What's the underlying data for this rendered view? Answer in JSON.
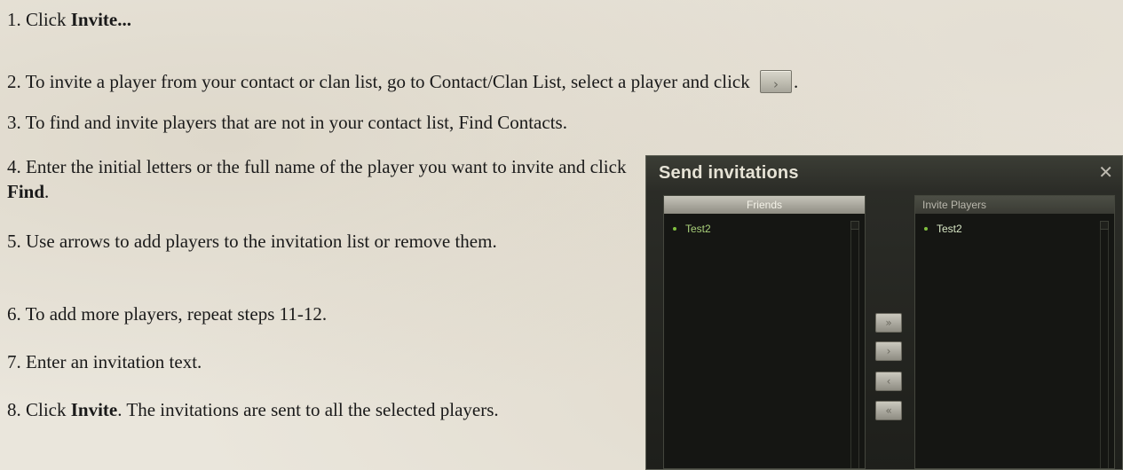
{
  "steps": [
    {
      "num": "1.",
      "pre": "Click ",
      "bold": "Invite...",
      "post": ""
    },
    {
      "num": "2.",
      "pre": "To invite a player from your contact or clan list, go to Contact/Clan List, select a player and click ",
      "button_glyph": "›",
      "post": "."
    },
    {
      "num": "3.",
      "pre": "To find and invite players that are not in your contact list, Find Contacts.",
      "bold": "",
      "post": ""
    },
    {
      "num": "4.",
      "pre": "Enter the initial letters or the full name of the player you want to invite and click ",
      "bold": "Find",
      "post": "."
    },
    {
      "num": "5.",
      "pre": "Use arrows to add players to the invitation list or remove them.",
      "bold": "",
      "post": ""
    },
    {
      "num": "6.",
      "pre": "To add more players, repeat steps 11-12.",
      "bold": "",
      "post": ""
    },
    {
      "num": "7.",
      "pre": "Enter an invitation text.",
      "bold": "",
      "post": ""
    },
    {
      "num": "8.",
      "pre": "Click ",
      "bold": "Invite",
      "post": ". The invitations are sent to all the selected players."
    }
  ],
  "dialog": {
    "title": "Send invitations",
    "close_icon": "close-icon",
    "left_panel": {
      "header": "Friends",
      "items": [
        "Test2"
      ]
    },
    "right_panel": {
      "header": "Invite Players",
      "items": [
        "Test2"
      ]
    },
    "arrows": {
      "add_all": "»",
      "add": "›",
      "remove": "‹",
      "remove_all": "«"
    }
  },
  "colors": {
    "page_bg": "#eae6dc",
    "dialog_bg": "#1e1f1b",
    "online_dot": "#7fbf3f",
    "text": "#1a1a1a"
  }
}
